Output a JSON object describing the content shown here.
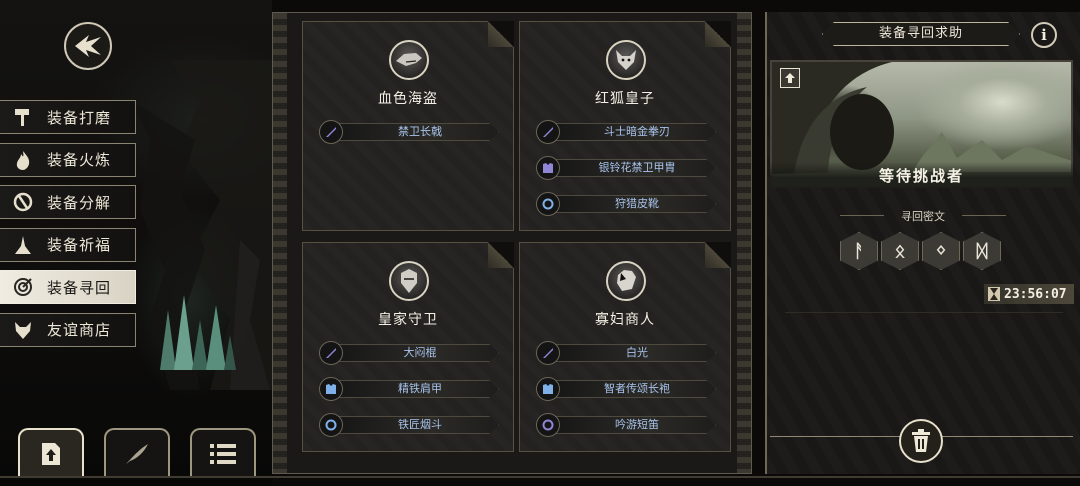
{
  "left_menu": {
    "items": [
      {
        "label": "装备打磨",
        "icon": "hammer-icon",
        "active": false
      },
      {
        "label": "装备火炼",
        "icon": "flame-icon",
        "active": false
      },
      {
        "label": "装备分解",
        "icon": "break-icon",
        "active": false
      },
      {
        "label": "装备祈福",
        "icon": "pray-icon",
        "active": false
      },
      {
        "label": "装备寻回",
        "icon": "target-icon",
        "active": true
      },
      {
        "label": "友谊商店",
        "icon": "fox-icon",
        "active": false
      }
    ]
  },
  "bottom_tabs": [
    {
      "icon": "upload-icon",
      "active": true
    },
    {
      "icon": "feather-icon",
      "active": false
    },
    {
      "icon": "list-icon",
      "active": false
    }
  ],
  "cards": [
    {
      "name": "血色海盗",
      "portrait": "shark-pirate-portrait",
      "items": [
        {
          "name": "禁卫长戟",
          "icon": "sword-icon"
        }
      ]
    },
    {
      "name": "红狐皇子",
      "portrait": "fox-prince-portrait",
      "items": [
        {
          "name": "斗士暗金拳刃",
          "icon": "sword-icon"
        },
        {
          "name": "银铃花禁卫甲胄",
          "icon": "armor-icon"
        },
        {
          "name": "狩猎皮靴",
          "icon": "ring-icon"
        }
      ]
    },
    {
      "name": "皇家守卫",
      "portrait": "royal-guard-portrait",
      "items": [
        {
          "name": "大闷棍",
          "icon": "sword-icon"
        },
        {
          "name": "精铁肩甲",
          "icon": "armor-icon"
        },
        {
          "name": "铁匠烟斗",
          "icon": "ring-icon"
        }
      ]
    },
    {
      "name": "寡妇商人",
      "portrait": "widow-merchant-portrait",
      "items": [
        {
          "name": "白光",
          "icon": "sword-icon"
        },
        {
          "name": "智者传颂长袍",
          "icon": "armor-icon"
        },
        {
          "name": "吟游短笛",
          "icon": "ring-icon"
        }
      ]
    }
  ],
  "right_panel": {
    "title": "装备寻回求助",
    "info_glyph": "i",
    "status": "等待挑战者",
    "cipher_label": "寻回密文",
    "runes": [
      "ᚨ",
      "ᛟ",
      "ᛜ",
      "ᛞ"
    ],
    "timer": "23:56:07"
  },
  "colors": {
    "item_text": "#a8c4ec",
    "active_menu_bg": "#f0ece2",
    "frame": "#5f5a4d"
  }
}
